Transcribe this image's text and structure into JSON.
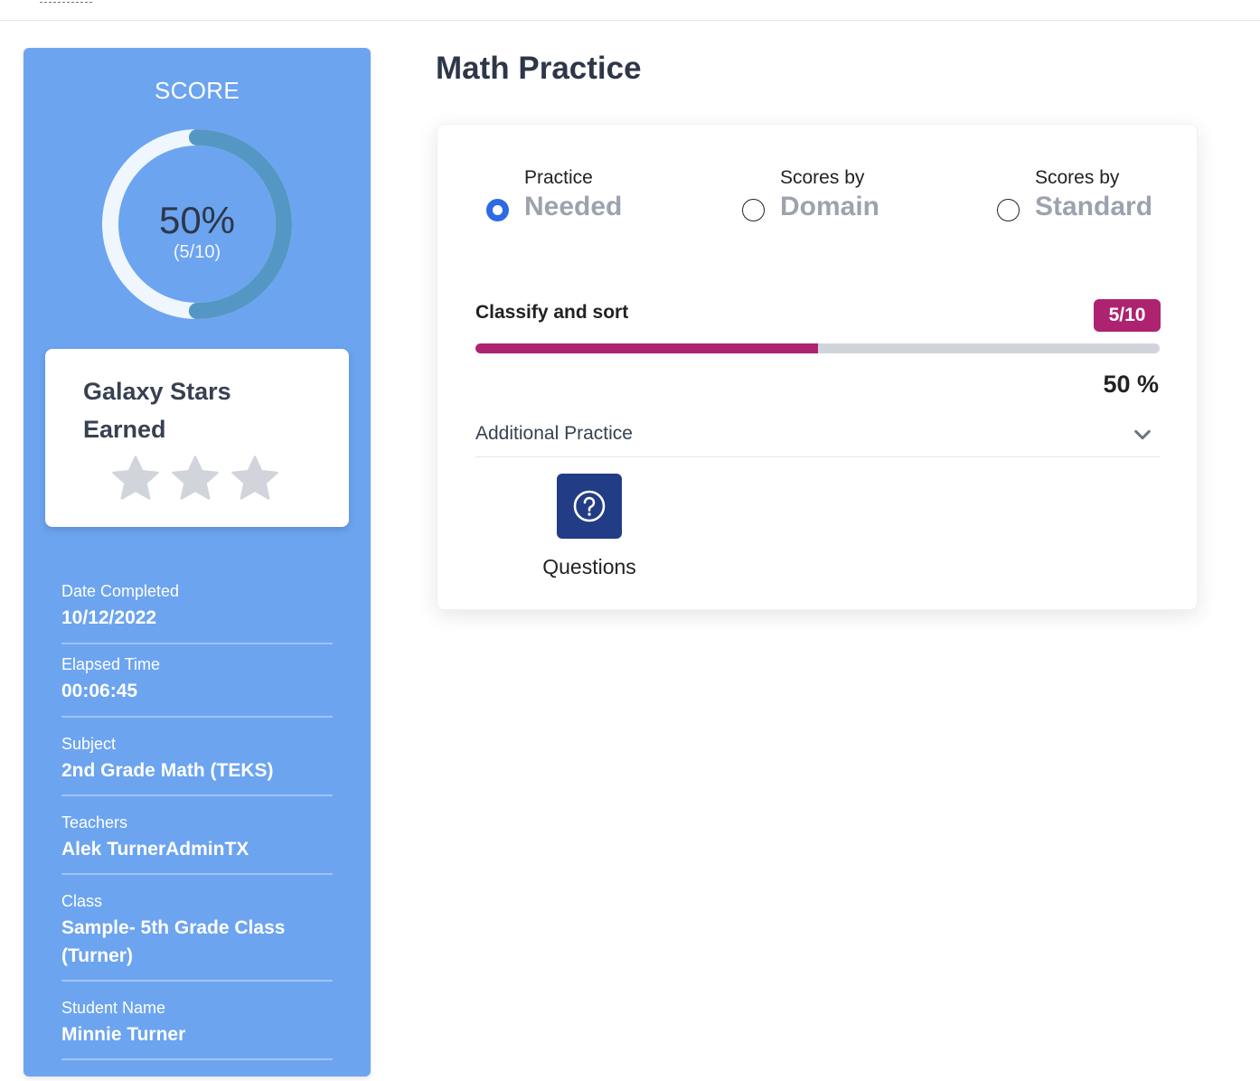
{
  "sidebar": {
    "score_title": "SCORE",
    "score": {
      "percent_label": "50%",
      "fraction_label": "(5/10)",
      "fraction": 0.5
    },
    "stars_card": {
      "title": "Galaxy Stars Earned",
      "stars_earned": 0,
      "stars_total": 3
    },
    "info": [
      {
        "label": "Date Completed",
        "value": "10/12/2022"
      },
      {
        "label": "Elapsed Time",
        "value": "00:06:45"
      },
      {
        "label": "Subject",
        "value": "2nd Grade Math (TEKS)"
      },
      {
        "label": "Teachers",
        "value": "Alek TurnerAdminTX"
      },
      {
        "label": "Class",
        "value": "Sample- 5th Grade Class (Turner)"
      },
      {
        "label": "Student Name",
        "value": "Minnie Turner"
      }
    ]
  },
  "main": {
    "title": "Math Practice",
    "view_options": [
      {
        "top": "Practice",
        "big": "Needed",
        "selected": true
      },
      {
        "top": "Scores by",
        "big": "Domain",
        "selected": false
      },
      {
        "top": "Scores by",
        "big": "Standard",
        "selected": false
      }
    ],
    "skill": {
      "name": "Classify and sort",
      "badge": "5/10",
      "progress": 0.5,
      "percent_label": "50 %"
    },
    "additional_practice_label": "Additional Practice",
    "questions_label": "Questions"
  },
  "colors": {
    "sidebar_bg": "#6ca4f0",
    "ring_fill": "#5597c4",
    "ring_track": "#eff6fe",
    "accent": "#ad236f",
    "radio_selected": "#2d6ae6",
    "questions_button": "#223d86",
    "star_empty": "#d1d5db"
  }
}
